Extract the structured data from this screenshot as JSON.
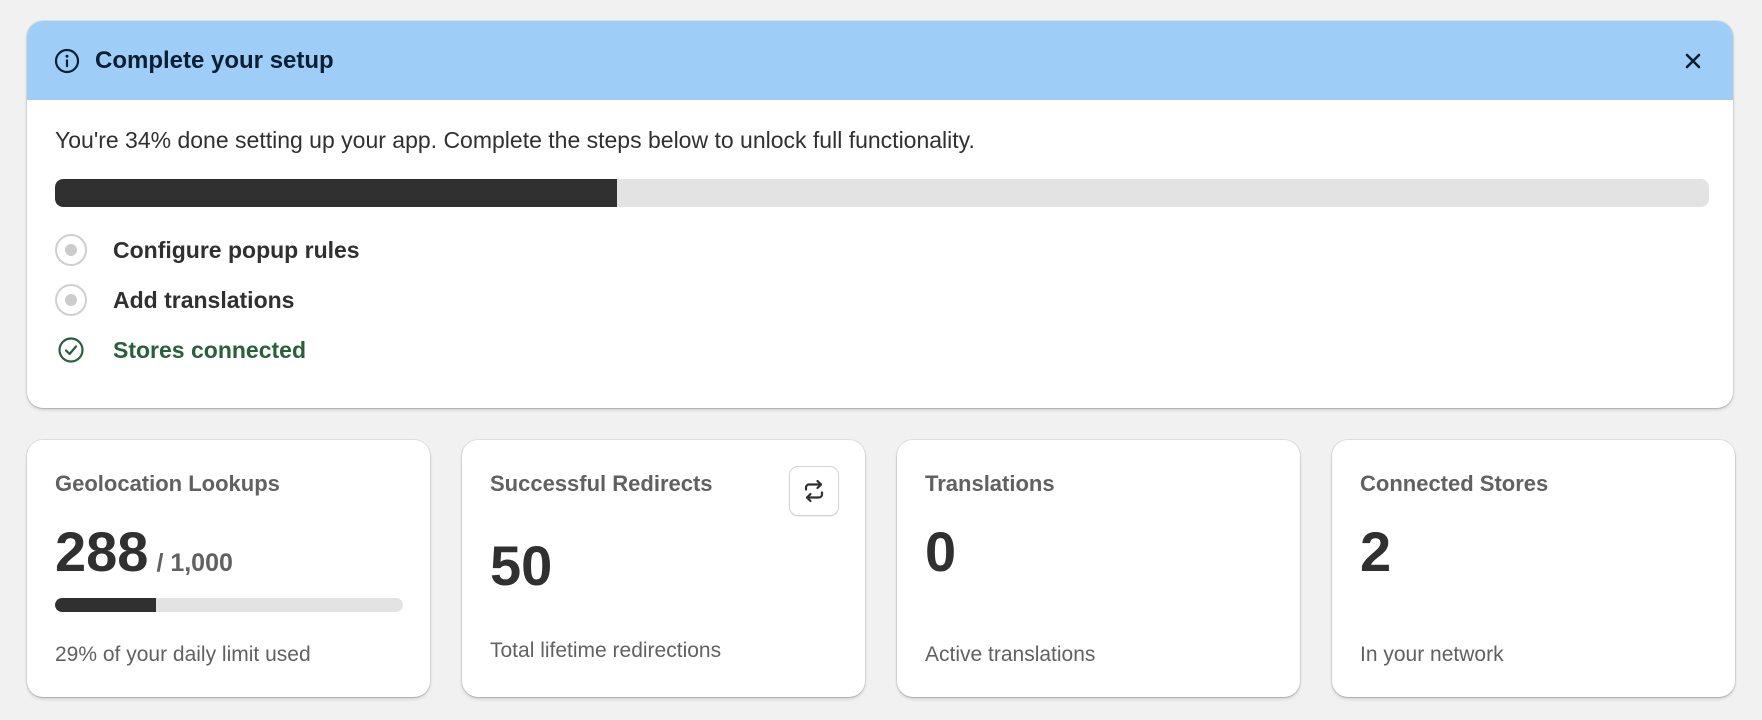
{
  "setup": {
    "title": "Complete your setup",
    "description": "You're 34% done setting up your app. Complete the steps below to unlock full functionality.",
    "progress_percent": 34,
    "steps": [
      {
        "label": "Configure popup rules",
        "completed": false
      },
      {
        "label": "Add translations",
        "completed": false
      },
      {
        "label": "Stores connected",
        "completed": true
      }
    ],
    "icons": {
      "info": "info-icon",
      "close": "close-icon",
      "complete": "check-circle-icon"
    },
    "colors": {
      "header_bg": "#9ecdf8",
      "completed_text": "#29603b",
      "progress_fill": "#303030"
    }
  },
  "stats": {
    "geolocation": {
      "title": "Geolocation Lookups",
      "value": "288",
      "limit": "/ 1,000",
      "usage_percent": 29,
      "caption": "29% of your daily limit used"
    },
    "redirects": {
      "title": "Successful Redirects",
      "value": "50",
      "caption": "Total lifetime redirections",
      "action_icon": "refresh-icon"
    },
    "translations": {
      "title": "Translations",
      "value": "0",
      "caption": "Active translations"
    },
    "stores": {
      "title": "Connected Stores",
      "value": "2",
      "caption": "In your network"
    }
  }
}
